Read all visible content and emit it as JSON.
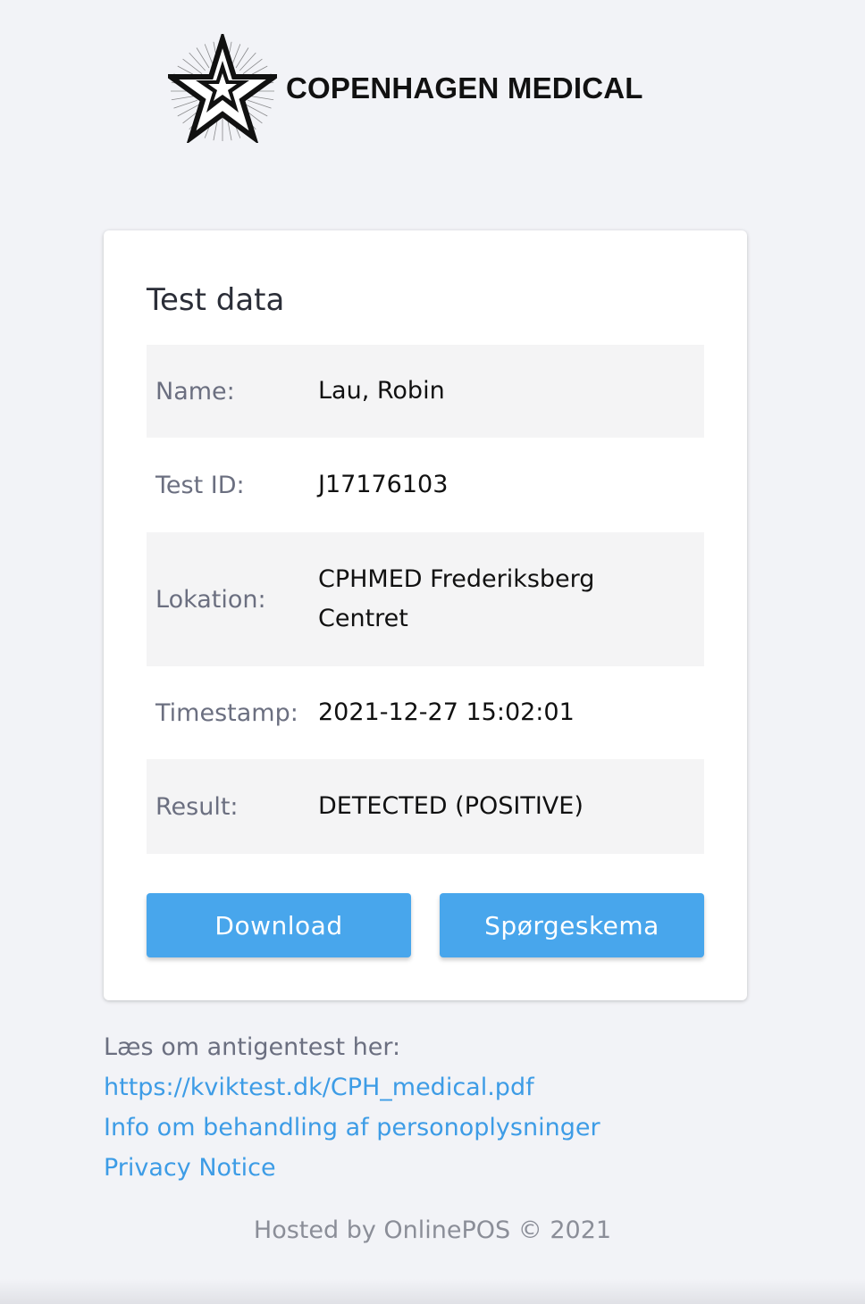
{
  "header": {
    "logo_text": "COPENHAGEN MEDICAL",
    "logo_icon": "star-logo-icon"
  },
  "card": {
    "title": "Test data",
    "rows": [
      {
        "label": "Name:",
        "value": "Lau, Robin"
      },
      {
        "label": "Test ID:",
        "value": "J17176103"
      },
      {
        "label": "Lokation:",
        "value": "CPHMED Frederiksberg Centret"
      },
      {
        "label": "Timestamp:",
        "value": "2021-12-27 15:02:01"
      },
      {
        "label": "Result:",
        "value": "DETECTED (POSITIVE)"
      }
    ],
    "buttons": {
      "download_label": "Download",
      "survey_label": "Spørgeskema"
    }
  },
  "info": {
    "intro": "Læs om antigentest her:",
    "links": [
      "https://kviktest.dk/CPH_medical.pdf",
      "Info om behandling af personoplysninger",
      "Privacy Notice"
    ]
  },
  "footer": {
    "text": "Hosted by OnlinePOS © 2021"
  },
  "colors": {
    "background": "#f2f3f7",
    "button": "#48a6ec",
    "link": "#3d9ce6",
    "row_shade": "#f4f4f5"
  }
}
